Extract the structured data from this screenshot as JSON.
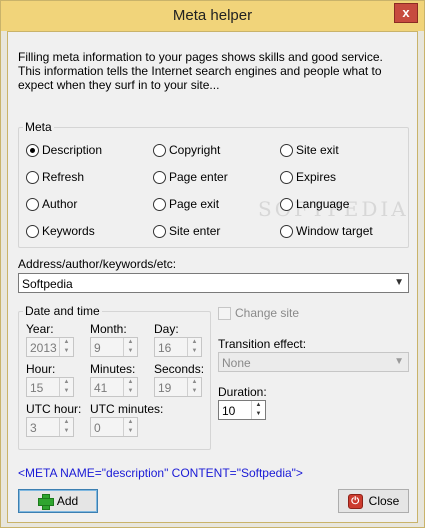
{
  "window": {
    "title": "Meta helper",
    "close_glyph": "x"
  },
  "intro_text": "Filling meta information to your pages shows skills and good service. This information tells the Internet search engines and people what to expect when they surf in to your site...",
  "meta_group": {
    "legend": "Meta",
    "options": [
      {
        "label": "Description",
        "selected": true
      },
      {
        "label": "Refresh",
        "selected": false
      },
      {
        "label": "Author",
        "selected": false
      },
      {
        "label": "Keywords",
        "selected": false
      },
      {
        "label": "Copyright",
        "selected": false
      },
      {
        "label": "Page enter",
        "selected": false
      },
      {
        "label": "Page exit",
        "selected": false
      },
      {
        "label": "Site enter",
        "selected": false
      },
      {
        "label": "Site exit",
        "selected": false
      },
      {
        "label": "Expires",
        "selected": false
      },
      {
        "label": "Language",
        "selected": false
      },
      {
        "label": "Window target",
        "selected": false
      }
    ]
  },
  "address": {
    "label": "Address/author/keywords/etc:",
    "value": "Softpedia"
  },
  "datetime": {
    "legend": "Date and time",
    "year_label": "Year:",
    "year": "2013",
    "month_label": "Month:",
    "month": "9",
    "day_label": "Day:",
    "day": "16",
    "hour_label": "Hour:",
    "hour": "15",
    "minutes_label": "Minutes:",
    "minutes": "41",
    "seconds_label": "Seconds:",
    "seconds": "19",
    "utc_hour_label": "UTC hour:",
    "utc_hour": "3",
    "utc_minutes_label": "UTC minutes:",
    "utc_minutes": "0"
  },
  "site": {
    "change_site_label": "Change site",
    "change_site_checked": false,
    "transition_label": "Transition effect:",
    "transition_value": "None",
    "duration_label": "Duration:",
    "duration_value": "10"
  },
  "output_text": "<META NAME=\"description\" CONTENT=\"Softpedia\">",
  "buttons": {
    "add": "Add",
    "close": "Close"
  },
  "watermark": "SOFTPEDIA",
  "icons": {
    "add": "plus-icon",
    "close": "power-icon",
    "dropdown": "chevron-down-icon",
    "spin_up": "spin-up-icon",
    "spin_down": "spin-down-icon"
  }
}
